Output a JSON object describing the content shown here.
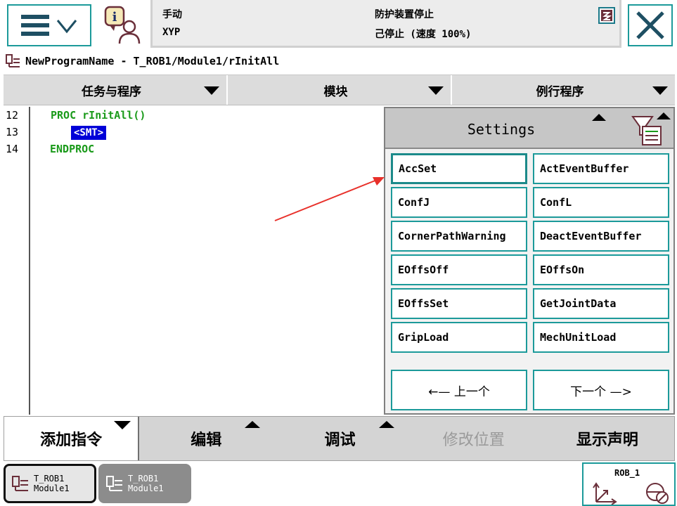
{
  "status": {
    "mode": "手动",
    "controller": "XYP",
    "state": "防护装置停止",
    "speed_state": "己停止 (速度 100%)"
  },
  "path": "NewProgramName - T_ROB1/Module1/rInitAll",
  "tabs": [
    {
      "label": "任务与程序"
    },
    {
      "label": "模块"
    },
    {
      "label": "例行程序"
    }
  ],
  "editor": {
    "lines": [
      {
        "no": "12",
        "text": "PROC rInitAll()"
      },
      {
        "no": "13",
        "text": "<SMT>"
      },
      {
        "no": "14",
        "text": "ENDPROC"
      }
    ]
  },
  "settings": {
    "title": "Settings",
    "items": [
      "AccSet",
      "ActEventBuffer",
      "ConfJ",
      "ConfL",
      "CornerPathWarning",
      "DeactEventBuffer",
      "EOffsOff",
      "EOffsOn",
      "EOffsSet",
      "GetJointData",
      "GripLoad",
      "MechUnitLoad"
    ],
    "prev_label": "←—  上一个",
    "next_label": "下一个  —>"
  },
  "bottom": {
    "add_instruction": "添加指令",
    "edit": "编辑",
    "debug": "调试",
    "modify_position": "修改位置",
    "show_declaration": "显示声明"
  },
  "taskbar": [
    {
      "line1": "T_ROB1",
      "line2": "Module1"
    },
    {
      "line1": "T_ROB1",
      "line2": "Module1"
    }
  ],
  "robot": {
    "label": "ROB_1"
  },
  "colors": {
    "accent": "#1c9a9a",
    "code_green": "#1a9a1a",
    "selection_blue": "#0000d8",
    "annotation_red": "#e8302a"
  }
}
